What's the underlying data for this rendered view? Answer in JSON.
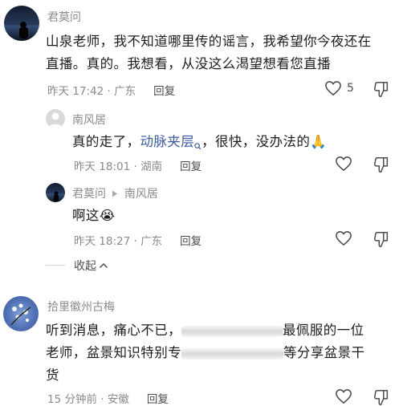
{
  "comments": [
    {
      "author": "君莫问",
      "text_line1": "山泉老师，我不知道哪里传的谣言，我希望你今夜还在",
      "text_line2": "直播。真的。我想看，从没这么渴望想看您直播",
      "time": "昨天 17:42 · 广东",
      "reply_label": "回复",
      "like_count": "5"
    },
    {
      "author": "南风居",
      "text_before": "真的走了，",
      "link_text": "动脉夹层",
      "text_after": "，很快，没办法的",
      "emoji": "🙏",
      "time": "昨天 18:01 · 湖南",
      "reply_label": "回复"
    },
    {
      "author": "君莫问",
      "reply_to": "南风居",
      "text": "啊这",
      "emoji": "😭",
      "time": "昨天 18:27 · 广东",
      "reply_label": "回复"
    },
    {
      "author": "拾里徽州古梅",
      "line1_before": "听到消息，痛心不已，",
      "line1_after": "最佩服的一位",
      "line2_before": "老师，盆景知识特别专",
      "line2_after": "等分享盆景干",
      "line3": "货",
      "time": "15 分钟前 · 安徽",
      "reply_label": "回复"
    }
  ],
  "collapse_label": "收起",
  "colors": {
    "link": "#3b5b9a",
    "meta": "#8b8b8b"
  }
}
